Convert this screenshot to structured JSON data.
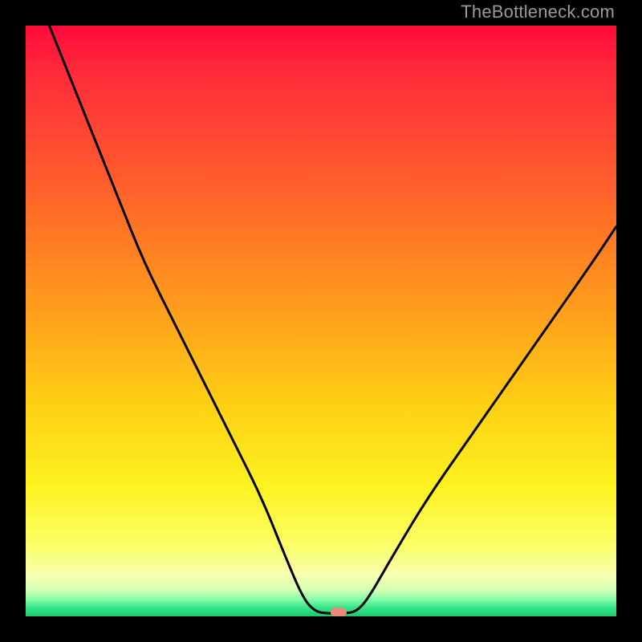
{
  "watermark": "TheBottleneck.com",
  "chart_data": {
    "type": "line",
    "title": "",
    "xlabel": "",
    "ylabel": "",
    "xlim": [
      0,
      100
    ],
    "ylim": [
      0,
      100
    ],
    "grid": false,
    "legend": false,
    "curve": [
      {
        "x": 4.0,
        "y": 100.0
      },
      {
        "x": 8.0,
        "y": 90.0
      },
      {
        "x": 12.0,
        "y": 80.0
      },
      {
        "x": 16.0,
        "y": 70.0
      },
      {
        "x": 20.0,
        "y": 60.0
      },
      {
        "x": 25.0,
        "y": 50.0
      },
      {
        "x": 30.0,
        "y": 40.0
      },
      {
        "x": 35.0,
        "y": 30.0
      },
      {
        "x": 40.0,
        "y": 20.0
      },
      {
        "x": 44.0,
        "y": 10.0
      },
      {
        "x": 47.0,
        "y": 3.0
      },
      {
        "x": 49.0,
        "y": 0.8
      },
      {
        "x": 51.0,
        "y": 0.5
      },
      {
        "x": 54.0,
        "y": 0.5
      },
      {
        "x": 56.0,
        "y": 0.8
      },
      {
        "x": 58.0,
        "y": 3.0
      },
      {
        "x": 62.0,
        "y": 10.0
      },
      {
        "x": 68.0,
        "y": 20.0
      },
      {
        "x": 75.0,
        "y": 30.0
      },
      {
        "x": 82.0,
        "y": 40.0
      },
      {
        "x": 89.0,
        "y": 50.0
      },
      {
        "x": 96.0,
        "y": 60.0
      },
      {
        "x": 100.0,
        "y": 66.0
      }
    ],
    "minimum_marker": {
      "x": 53.0,
      "y": 0.65
    },
    "colors": {
      "curve": "#000000",
      "marker": "#e7897b"
    }
  }
}
